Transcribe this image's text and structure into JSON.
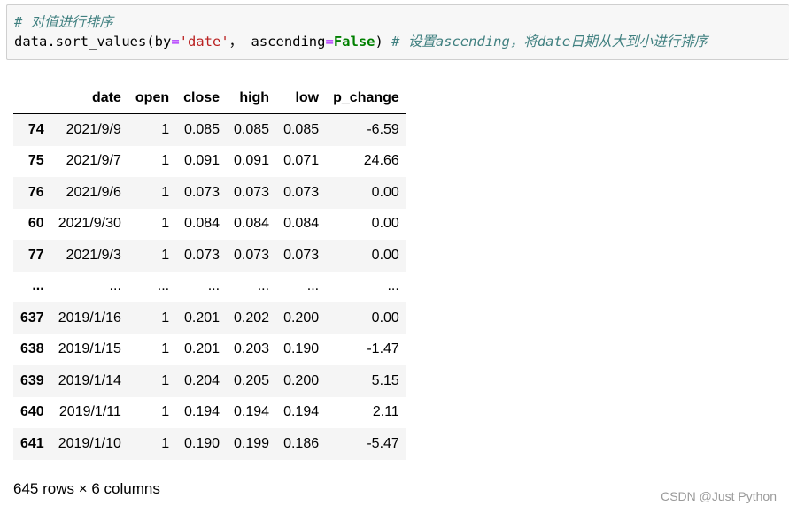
{
  "code_cell": {
    "comment_line": "# 对值进行排序",
    "code_prefix": "data.sort_values(by",
    "eq1": "=",
    "string_arg": "'date'",
    "mid": "， ascending",
    "eq2": "=",
    "keyword": "False",
    "close": ") ",
    "inline_comment": "# 设置ascending，将date日期从大到小进行排序"
  },
  "table": {
    "columns": [
      "",
      "date",
      "open",
      "close",
      "high",
      "low",
      "p_change"
    ],
    "rows": [
      [
        "74",
        "2021/9/9",
        "1",
        "0.085",
        "0.085",
        "0.085",
        "-6.59"
      ],
      [
        "75",
        "2021/9/7",
        "1",
        "0.091",
        "0.091",
        "0.071",
        "24.66"
      ],
      [
        "76",
        "2021/9/6",
        "1",
        "0.073",
        "0.073",
        "0.073",
        "0.00"
      ],
      [
        "60",
        "2021/9/30",
        "1",
        "0.084",
        "0.084",
        "0.084",
        "0.00"
      ],
      [
        "77",
        "2021/9/3",
        "1",
        "0.073",
        "0.073",
        "0.073",
        "0.00"
      ],
      [
        "...",
        "...",
        "...",
        "...",
        "...",
        "...",
        "..."
      ],
      [
        "637",
        "2019/1/16",
        "1",
        "0.201",
        "0.202",
        "0.200",
        "0.00"
      ],
      [
        "638",
        "2019/1/15",
        "1",
        "0.201",
        "0.203",
        "0.190",
        "-1.47"
      ],
      [
        "639",
        "2019/1/14",
        "1",
        "0.204",
        "0.205",
        "0.200",
        "5.15"
      ],
      [
        "640",
        "2019/1/11",
        "1",
        "0.194",
        "0.194",
        "0.194",
        "2.11"
      ],
      [
        "641",
        "2019/1/10",
        "1",
        "0.190",
        "0.199",
        "0.186",
        "-5.47"
      ]
    ]
  },
  "footer": "645 rows × 6 columns",
  "watermark": "CSDN @Just Python"
}
